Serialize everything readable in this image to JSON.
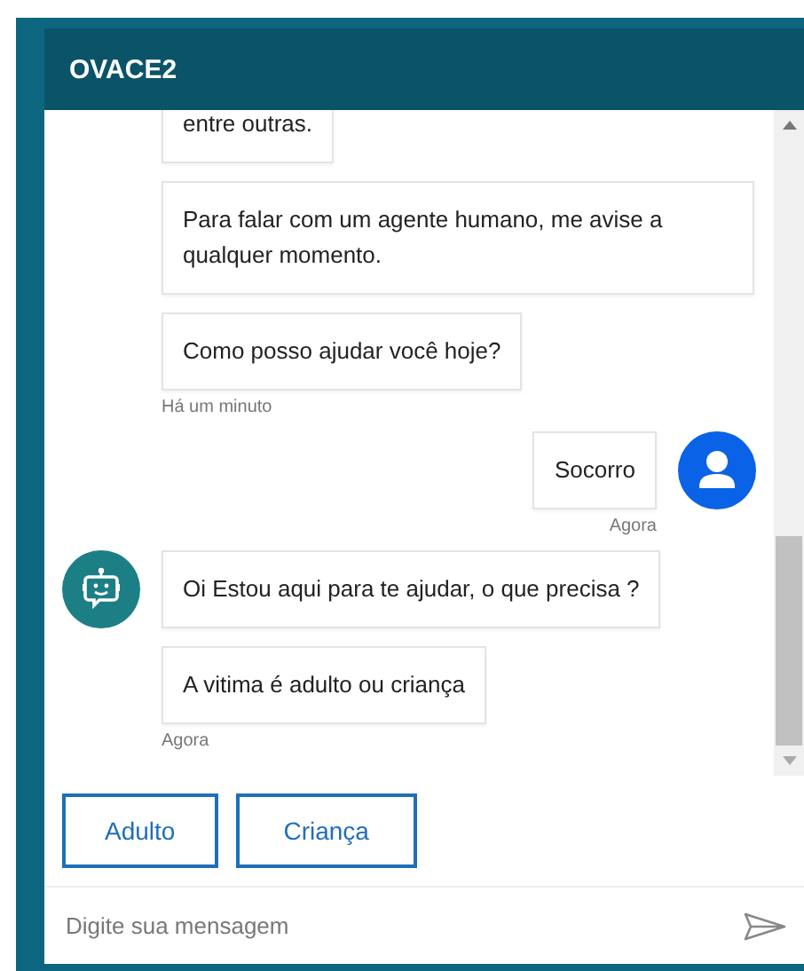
{
  "header": {
    "title": "OVACE2"
  },
  "groups": [
    {
      "kind": "bot",
      "avatar": false,
      "messages": [
        "entre outras.",
        "Para falar com um agente humano, me avise a qualquer momento.",
        "Como posso ajudar você hoje?"
      ],
      "time": "Há um minuto"
    },
    {
      "kind": "user",
      "avatar": true,
      "messages": [
        "Socorro"
      ],
      "time": "Agora"
    },
    {
      "kind": "bot",
      "avatar": true,
      "messages": [
        "Oi Estou aqui para te ajudar, o que precisa ?",
        "A vitima é adulto ou criança"
      ],
      "time": "Agora"
    }
  ],
  "quick_replies": [
    "Adulto",
    "Criança"
  ],
  "composer": {
    "placeholder": "Digite sua mensagem"
  }
}
